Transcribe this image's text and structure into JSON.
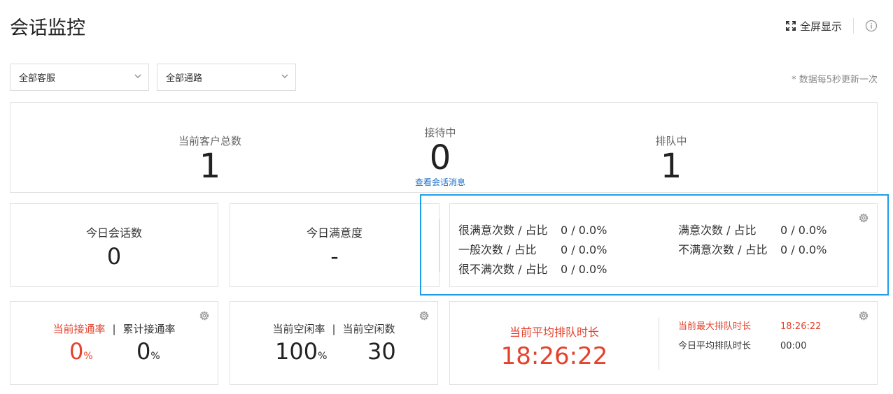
{
  "page": {
    "title": "会话监控"
  },
  "topbar": {
    "fullscreen_label": "全屏显示"
  },
  "filters": {
    "agent_select": "全部客服",
    "channel_select": "全部通路",
    "refresh_note": "* 数据每5秒更新一次"
  },
  "summary": {
    "total_label": "当前客户总数",
    "total_value": "1",
    "serving_label": "接待中",
    "serving_value": "0",
    "view_messages_link": "查看会话消息",
    "queue_label": "排队中",
    "queue_value": "1"
  },
  "today_sessions": {
    "label": "今日会话数",
    "value": "0"
  },
  "today_satisfaction": {
    "label": "今日满意度",
    "value": "-"
  },
  "satisfaction_breakdown": {
    "very_satisfied_label": "很满意次数 / 占比",
    "very_satisfied_value": "0 / 0.0%",
    "satisfied_label": "满意次数 / 占比",
    "satisfied_value": "0 / 0.0%",
    "neutral_label": "一般次数 / 占比",
    "neutral_value": "0 / 0.0%",
    "unsatisfied_label": "不满意次数 / 占比",
    "unsatisfied_value": "0 / 0.0%",
    "very_unsatisfied_label": "很不满次数 / 占比",
    "very_unsatisfied_value": "0 / 0.0%"
  },
  "connect_rate": {
    "current_label": "当前接通率",
    "separator": "|",
    "cumulative_label": "累计接通率",
    "current_value": "0",
    "cumulative_value": "0",
    "unit": "%"
  },
  "idle": {
    "rate_label": "当前空闲率",
    "separator": "|",
    "count_label": "当前空闲数",
    "rate_value": "100",
    "rate_unit": "%",
    "count_value": "30"
  },
  "queue_time": {
    "avg_label": "当前平均排队时长",
    "avg_value": "18:26:22",
    "max_label": "当前最大排队时长",
    "max_value": "18:26:22",
    "today_avg_label": "今日平均排队时长",
    "today_avg_value": "00:00"
  },
  "colors": {
    "accent_red": "#e5412c",
    "link_blue": "#1a6fc9",
    "highlight_blue": "#1f9de8"
  }
}
